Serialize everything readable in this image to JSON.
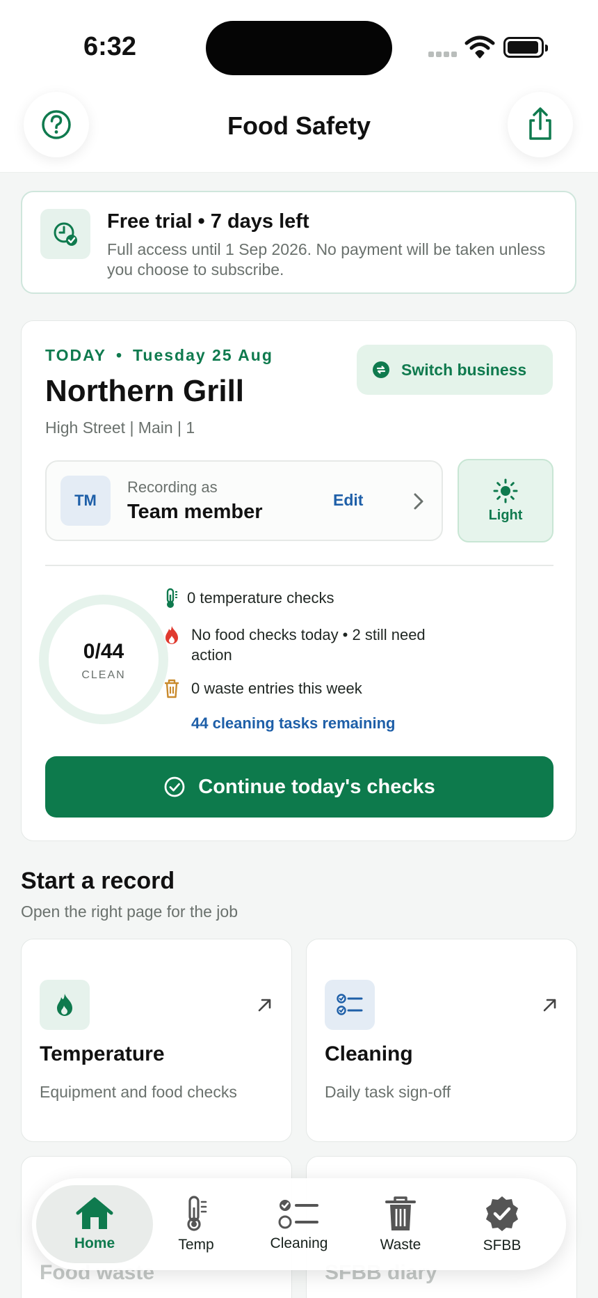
{
  "status_bar": {
    "time": "6:32"
  },
  "header": {
    "title": "Food Safety",
    "help_icon": "help-circle-icon",
    "share_icon": "share-icon"
  },
  "trial": {
    "title": "Free trial • 7 days left",
    "text": "Full access until 1 Sep 2026. No payment will be taken unless you choose to subscribe."
  },
  "today": {
    "day_label": "TODAY",
    "date": "Tuesday 25 Aug",
    "business_name": "Northern Grill",
    "address": "High Street | Main | 1",
    "switch_label": "Switch business",
    "recording": {
      "avatar_initials": "TM",
      "label": "Recording as",
      "name": "Team member",
      "edit_label": "Edit"
    },
    "theme_label": "Light",
    "progress": {
      "value_text": "0/44",
      "label": "CLEAN",
      "done": 0,
      "total": 44
    },
    "stats": {
      "temperature": "0 temperature checks",
      "food": "No food checks today • 2 still need action",
      "waste": "0 waste entries this week",
      "cleaning_link": "44 cleaning tasks remaining"
    },
    "continue_label": "Continue today's checks"
  },
  "start_record": {
    "title": "Start a record",
    "subtitle": "Open the right page for the job",
    "tiles": [
      {
        "title": "Temperature",
        "subtitle": "Equipment and food checks"
      },
      {
        "title": "Cleaning",
        "subtitle": "Daily task sign-off"
      },
      {
        "title": "Food waste"
      },
      {
        "title": "SFBB diary"
      }
    ]
  },
  "tabs": [
    {
      "label": "Home",
      "icon": "home-icon",
      "active": true
    },
    {
      "label": "Temp",
      "icon": "thermometer-icon"
    },
    {
      "label": "Cleaning",
      "icon": "checklist-icon"
    },
    {
      "label": "Waste",
      "icon": "trash-icon"
    },
    {
      "label": "SFBB",
      "icon": "badge-check-icon"
    }
  ],
  "colors": {
    "brand_green": "#0d7a4c",
    "link_blue": "#1e5fa8",
    "flame_red": "#e03a2f",
    "bin_amber": "#c98a2c"
  }
}
